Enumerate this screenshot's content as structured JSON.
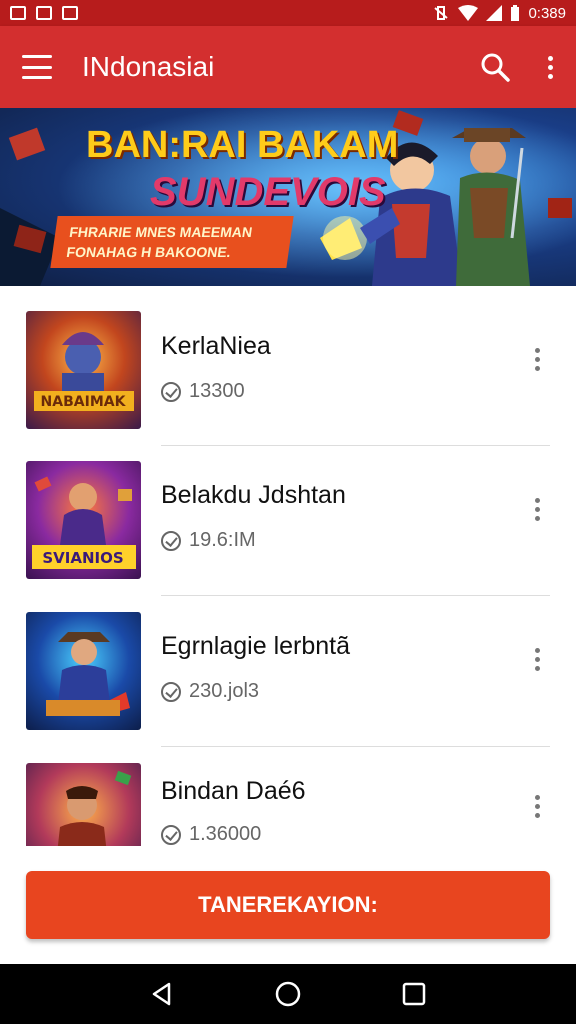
{
  "status_bar": {
    "time": "0:389"
  },
  "app_bar": {
    "title": "INdonasiai",
    "menu_icon": "hamburger-menu-icon",
    "search_icon": "search-icon",
    "overflow_icon": "more-vert-icon"
  },
  "banner": {
    "headline": "BAN:RAI BAKAM",
    "subheadline": "SUNDEVOIS",
    "ribbon_line1": "FHRARIE MNES MAEEMAN",
    "ribbon_line2": "FONAHAG H BAKOONE."
  },
  "list": {
    "items": [
      {
        "title": "KerlaNiea",
        "meta": "13300",
        "thumb_text": "NABAIMAK"
      },
      {
        "title": "Belakdu Jdshtan",
        "meta": "19.6:IM",
        "thumb_text": "SVIANIOS"
      },
      {
        "title": "Egrnlagie lerbntã",
        "meta": "230.jol3",
        "thumb_text": ""
      },
      {
        "title": "Bindan Daé6",
        "meta": "1.36000",
        "thumb_text": ""
      }
    ]
  },
  "cta": {
    "label": "TANEREKAYION:"
  },
  "colors": {
    "status_bar": "#b71c1c",
    "app_bar": "#d32f2f",
    "cta": "#e8451f"
  }
}
